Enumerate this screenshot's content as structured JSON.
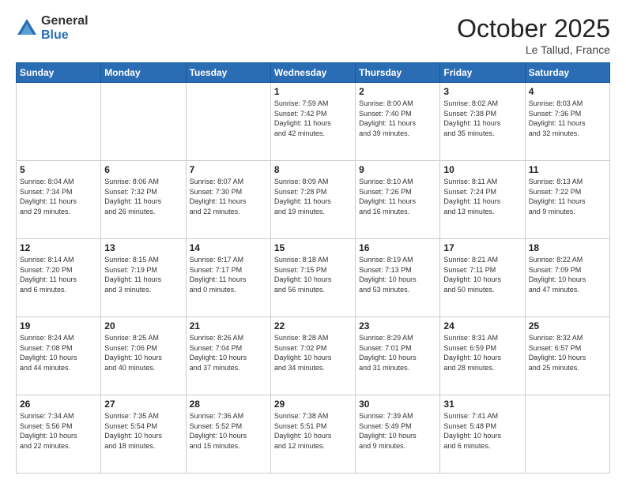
{
  "logo": {
    "general": "General",
    "blue": "Blue"
  },
  "title": "October 2025",
  "location": "Le Tallud, France",
  "days_of_week": [
    "Sunday",
    "Monday",
    "Tuesday",
    "Wednesday",
    "Thursday",
    "Friday",
    "Saturday"
  ],
  "weeks": [
    [
      {
        "day": "",
        "info": ""
      },
      {
        "day": "",
        "info": ""
      },
      {
        "day": "",
        "info": ""
      },
      {
        "day": "1",
        "info": "Sunrise: 7:59 AM\nSunset: 7:42 PM\nDaylight: 11 hours\nand 42 minutes."
      },
      {
        "day": "2",
        "info": "Sunrise: 8:00 AM\nSunset: 7:40 PM\nDaylight: 11 hours\nand 39 minutes."
      },
      {
        "day": "3",
        "info": "Sunrise: 8:02 AM\nSunset: 7:38 PM\nDaylight: 11 hours\nand 35 minutes."
      },
      {
        "day": "4",
        "info": "Sunrise: 8:03 AM\nSunset: 7:36 PM\nDaylight: 11 hours\nand 32 minutes."
      }
    ],
    [
      {
        "day": "5",
        "info": "Sunrise: 8:04 AM\nSunset: 7:34 PM\nDaylight: 11 hours\nand 29 minutes."
      },
      {
        "day": "6",
        "info": "Sunrise: 8:06 AM\nSunset: 7:32 PM\nDaylight: 11 hours\nand 26 minutes."
      },
      {
        "day": "7",
        "info": "Sunrise: 8:07 AM\nSunset: 7:30 PM\nDaylight: 11 hours\nand 22 minutes."
      },
      {
        "day": "8",
        "info": "Sunrise: 8:09 AM\nSunset: 7:28 PM\nDaylight: 11 hours\nand 19 minutes."
      },
      {
        "day": "9",
        "info": "Sunrise: 8:10 AM\nSunset: 7:26 PM\nDaylight: 11 hours\nand 16 minutes."
      },
      {
        "day": "10",
        "info": "Sunrise: 8:11 AM\nSunset: 7:24 PM\nDaylight: 11 hours\nand 13 minutes."
      },
      {
        "day": "11",
        "info": "Sunrise: 8:13 AM\nSunset: 7:22 PM\nDaylight: 11 hours\nand 9 minutes."
      }
    ],
    [
      {
        "day": "12",
        "info": "Sunrise: 8:14 AM\nSunset: 7:20 PM\nDaylight: 11 hours\nand 6 minutes."
      },
      {
        "day": "13",
        "info": "Sunrise: 8:15 AM\nSunset: 7:19 PM\nDaylight: 11 hours\nand 3 minutes."
      },
      {
        "day": "14",
        "info": "Sunrise: 8:17 AM\nSunset: 7:17 PM\nDaylight: 11 hours\nand 0 minutes."
      },
      {
        "day": "15",
        "info": "Sunrise: 8:18 AM\nSunset: 7:15 PM\nDaylight: 10 hours\nand 56 minutes."
      },
      {
        "day": "16",
        "info": "Sunrise: 8:19 AM\nSunset: 7:13 PM\nDaylight: 10 hours\nand 53 minutes."
      },
      {
        "day": "17",
        "info": "Sunrise: 8:21 AM\nSunset: 7:11 PM\nDaylight: 10 hours\nand 50 minutes."
      },
      {
        "day": "18",
        "info": "Sunrise: 8:22 AM\nSunset: 7:09 PM\nDaylight: 10 hours\nand 47 minutes."
      }
    ],
    [
      {
        "day": "19",
        "info": "Sunrise: 8:24 AM\nSunset: 7:08 PM\nDaylight: 10 hours\nand 44 minutes."
      },
      {
        "day": "20",
        "info": "Sunrise: 8:25 AM\nSunset: 7:06 PM\nDaylight: 10 hours\nand 40 minutes."
      },
      {
        "day": "21",
        "info": "Sunrise: 8:26 AM\nSunset: 7:04 PM\nDaylight: 10 hours\nand 37 minutes."
      },
      {
        "day": "22",
        "info": "Sunrise: 8:28 AM\nSunset: 7:02 PM\nDaylight: 10 hours\nand 34 minutes."
      },
      {
        "day": "23",
        "info": "Sunrise: 8:29 AM\nSunset: 7:01 PM\nDaylight: 10 hours\nand 31 minutes."
      },
      {
        "day": "24",
        "info": "Sunrise: 8:31 AM\nSunset: 6:59 PM\nDaylight: 10 hours\nand 28 minutes."
      },
      {
        "day": "25",
        "info": "Sunrise: 8:32 AM\nSunset: 6:57 PM\nDaylight: 10 hours\nand 25 minutes."
      }
    ],
    [
      {
        "day": "26",
        "info": "Sunrise: 7:34 AM\nSunset: 5:56 PM\nDaylight: 10 hours\nand 22 minutes."
      },
      {
        "day": "27",
        "info": "Sunrise: 7:35 AM\nSunset: 5:54 PM\nDaylight: 10 hours\nand 18 minutes."
      },
      {
        "day": "28",
        "info": "Sunrise: 7:36 AM\nSunset: 5:52 PM\nDaylight: 10 hours\nand 15 minutes."
      },
      {
        "day": "29",
        "info": "Sunrise: 7:38 AM\nSunset: 5:51 PM\nDaylight: 10 hours\nand 12 minutes."
      },
      {
        "day": "30",
        "info": "Sunrise: 7:39 AM\nSunset: 5:49 PM\nDaylight: 10 hours\nand 9 minutes."
      },
      {
        "day": "31",
        "info": "Sunrise: 7:41 AM\nSunset: 5:48 PM\nDaylight: 10 hours\nand 6 minutes."
      },
      {
        "day": "",
        "info": ""
      }
    ]
  ]
}
